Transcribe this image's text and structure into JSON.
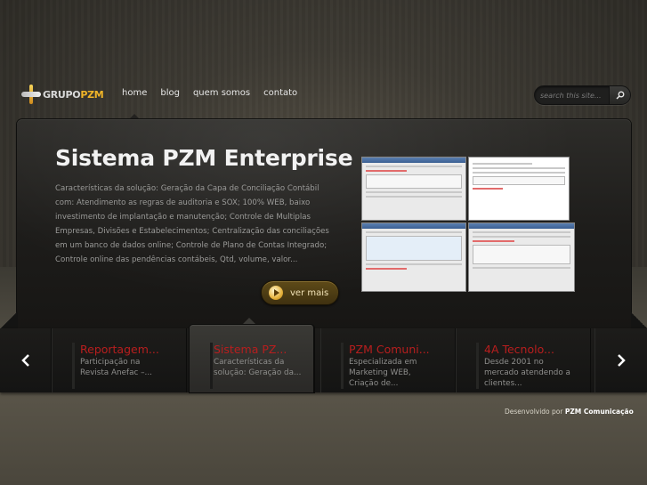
{
  "header": {
    "logo": {
      "grupo": "GRUPO",
      "pzm": "PZM"
    },
    "nav": [
      "home",
      "blog",
      "quem somos",
      "contato"
    ],
    "search": {
      "placeholder": "search this site..."
    }
  },
  "slide": {
    "title": "Sistema PZM Enterprise",
    "description": "Características da solução: Geração da Capa de Conciliação Contábil com: Atendimento as regras de auditoria e SOX; 100% WEB, baixo investimento de implantação e manutenção; Controle de Multiplas Empresas, Divisões e Estabelecimentos; Centralização das conciliações em um banco de dados online; Controle de Plano de Contas Integrado; Controle online das pendências contábeis, Qtd, volume, valor...",
    "button": "ver mais"
  },
  "tabs": [
    {
      "title": "Reportagem...",
      "desc": "Participação na Revista Anefac –..."
    },
    {
      "title": "Sistema PZ...",
      "desc": "Características da solução: Geração da..."
    },
    {
      "title": "PZM Comuni...",
      "desc": "Especializada em Marketing WEB, Criação de..."
    },
    {
      "title": "4A Tecnolo...",
      "desc": "Desde 2001 no mercado atendendo a clientes..."
    }
  ],
  "footer": {
    "prefix": "Desenvolvido por",
    "company": "PZM Comunicação"
  }
}
